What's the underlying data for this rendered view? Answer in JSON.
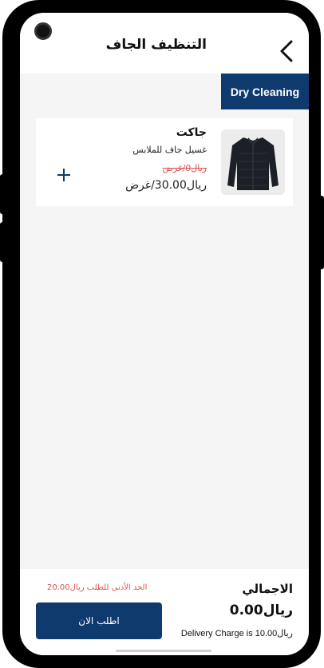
{
  "header": {
    "title": "التنظيف الجاف",
    "back_icon": "chevron-left-icon"
  },
  "category": {
    "label": "Dry Cleaning",
    "color": "#0f3a6d"
  },
  "product": {
    "name": "جاكت",
    "description": "غسيل جاف للملابس",
    "old_price": "ريال0/غرض",
    "price": "ريال30.00/غرض",
    "add_icon": "plus-icon",
    "image_icon": "jacket-icon"
  },
  "footer": {
    "total_label": "الاجمالي",
    "total_amount": "ريال0.00",
    "delivery_note": "Delivery Charge is ريال10.00",
    "min_order": "الحد الأدنى للطلب ريال20.00",
    "order_button": "اطلب الان"
  },
  "colors": {
    "primary": "#0f3a6d",
    "warning": "#d9534f",
    "background": "#f5f5f5"
  }
}
